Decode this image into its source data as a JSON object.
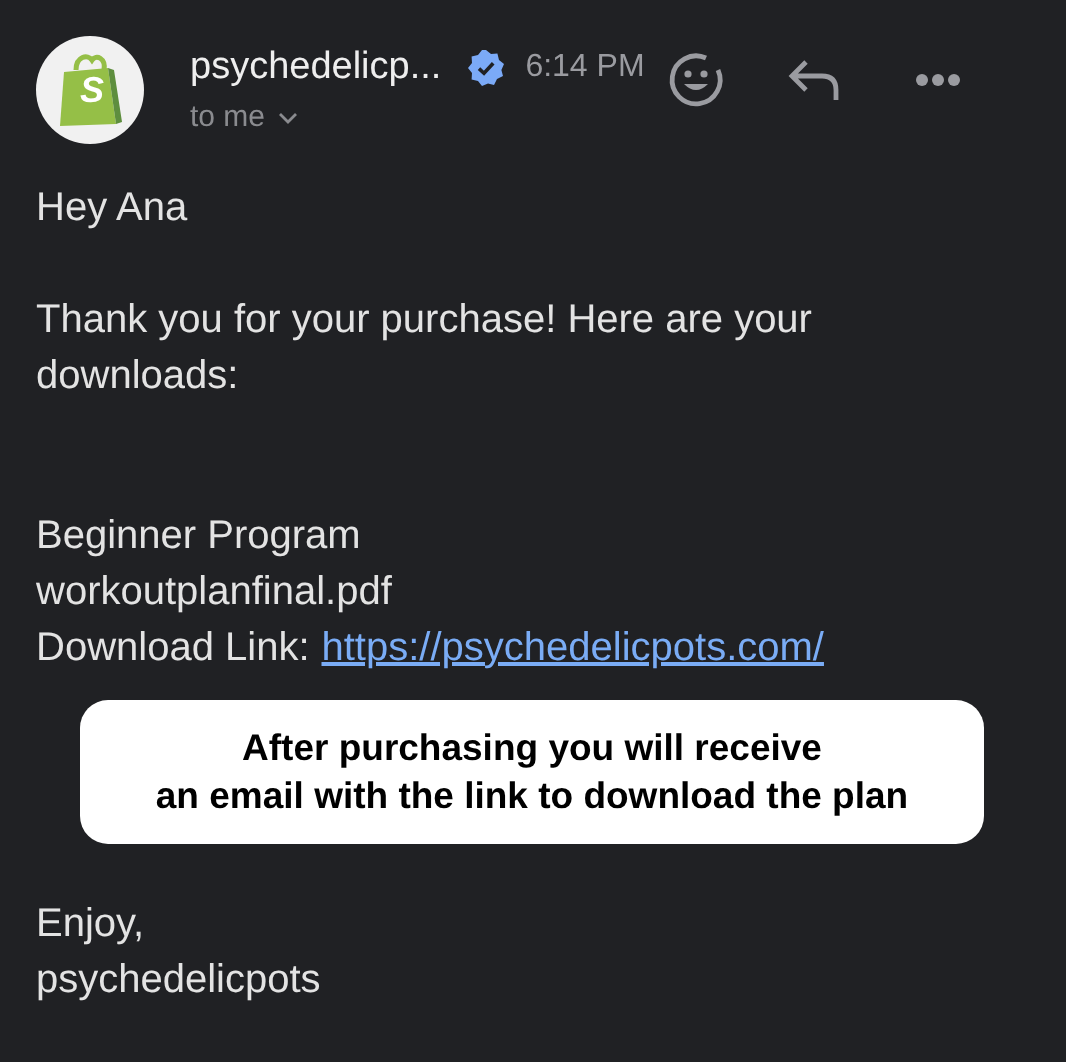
{
  "header": {
    "logo_letter": "S",
    "sender": "psychedelicp...",
    "verified": true,
    "time": "6:14 PM",
    "recipient": "to me"
  },
  "body": {
    "greeting": "Hey Ana",
    "message": "Thank you for your purchase! Here are your downloads:",
    "download": {
      "product": "Beginner Program",
      "file": "workoutplanfinal.pdf",
      "link_label": "Download Link:",
      "link": "https://psychedelicpots.com/"
    },
    "signoff": [
      "Enjoy,",
      "psychedelicpots"
    ]
  },
  "callout": [
    "After purchasing you will receive",
    "an email with the link to download the plan"
  ]
}
